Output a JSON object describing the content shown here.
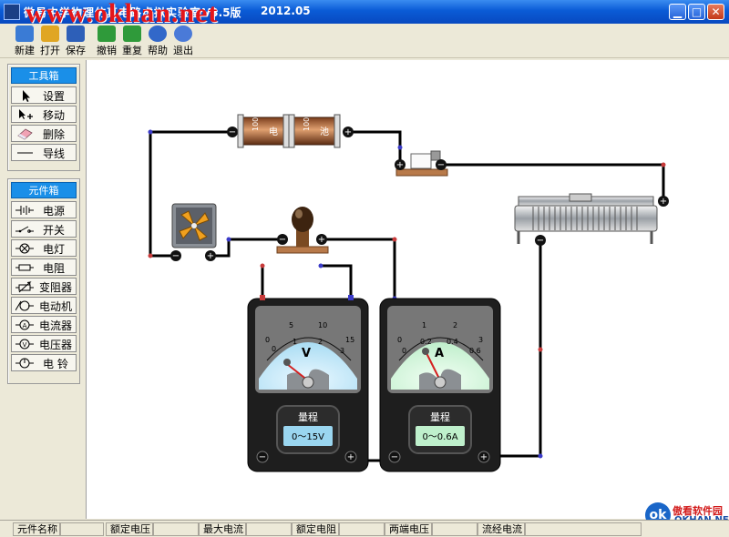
{
  "window": {
    "title": "微易中学物理仿真电路虚拟实验室",
    "version": "V3.5版",
    "date": "2012.05",
    "watermark": "www.okhan.net",
    "min_glyph": "▁",
    "max_glyph": "□",
    "close_glyph": "✕"
  },
  "toolbar": {
    "items": [
      {
        "label": "新建",
        "color": "#3a7bd5"
      },
      {
        "label": "打开",
        "color": "#e0a623"
      },
      {
        "label": "保存",
        "color": "#2d5fb8"
      },
      {
        "label": "撤销",
        "color": "#2f9a3a"
      },
      {
        "label": "重复",
        "color": "#2f9a3a"
      },
      {
        "label": "帮助",
        "color": "#3268c9"
      },
      {
        "label": "退出",
        "color": "#4a7ad8"
      }
    ]
  },
  "toolbox": {
    "title": "工具箱",
    "items": [
      "设置",
      "移动",
      "删除",
      "导线"
    ]
  },
  "components": {
    "title": "元件箱",
    "items": [
      "电源",
      "开关",
      "电灯",
      "电阻",
      "变阻器",
      "电动机",
      "电流器",
      "电压器",
      "电 铃"
    ]
  },
  "circuit": {
    "battery_label_1": "1000mA",
    "battery_label_2": "1000mA",
    "battery_glyph_1": "电",
    "battery_glyph_2": "池",
    "voltmeter": {
      "symbol": "V",
      "scale_top": [
        "0",
        "5",
        "10",
        "15"
      ],
      "scale_bottom": [
        "0",
        "1",
        "2",
        "3"
      ],
      "range_title": "量程",
      "range": "0～15V"
    },
    "ammeter": {
      "symbol": "A",
      "scale_top": [
        "0",
        "1",
        "2",
        "3"
      ],
      "scale_bottom": [
        "0",
        "0.2",
        "0.4",
        "0.6"
      ],
      "range_title": "量程",
      "range": "0～0.6A"
    }
  },
  "statusbar": {
    "fields": [
      "元件名称",
      "额定电压",
      "最大电流",
      "额定电阻",
      "两端电压",
      "流经电流"
    ]
  },
  "logo": {
    "mark": "ok",
    "cn": "傲看软件园",
    "en": "OKHAN.NET"
  }
}
